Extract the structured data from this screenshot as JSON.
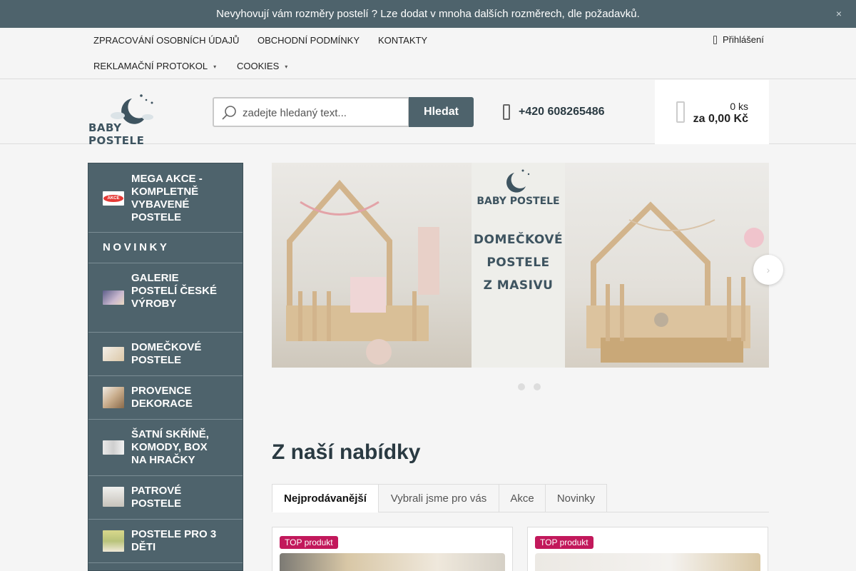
{
  "announcement": {
    "text": "Nevyhovují vám rozměry postelí ? Lze dodat v mnoha dalších rozměrech, dle požadavků.",
    "close_icon": "×"
  },
  "topnav": {
    "links": [
      "ZPRACOVÁNÍ OSOBNÍCH ÚDAJŮ",
      "OBCHODNÍ PODMÍNKY",
      "KONTAKTY",
      "REKLAMAČNÍ PROTOKOL",
      "COOKIES"
    ],
    "caret": "▾",
    "login": "Přihlášení"
  },
  "header": {
    "logo_text": "BABY POSTELE",
    "search_placeholder": "zadejte hledaný text...",
    "search_button": "Hledat",
    "phone": "+420 608265486",
    "cart_count": "0 ks",
    "cart_total": "za 0,00 Kč"
  },
  "sidebar": {
    "items": [
      {
        "label": "MEGA AKCE - KOMPLETNĚ VYBAVENÉ POSTELE",
        "thumb": "akce-badge",
        "thumb_text": "AKCE"
      },
      {
        "label": "NOVINKY",
        "thumb": ""
      },
      {
        "label": "GALERIE POSTELÍ ČESKÉ VÝROBY",
        "thumb": "gallery-photo"
      },
      {
        "label": "DOMEČKOVÉ POSTELE",
        "thumb": "house-bed-photo"
      },
      {
        "label": "PROVENCE DEKORACE",
        "thumb": "decor-photo"
      },
      {
        "label": "ŠATNÍ SKŘÍNĚ, KOMODY, BOX NA HRAČKY",
        "thumb": "wardrobe-photo"
      },
      {
        "label": "PATROVÉ POSTELE",
        "thumb": "bunk-bed-photo"
      },
      {
        "label": "POSTELE PRO 3 DĚTI",
        "thumb": "triple-bed-photo"
      }
    ]
  },
  "banner": {
    "brand": "BABY POSTELE",
    "lines": [
      "DOMEČKOVÉ",
      "POSTELE",
      "Z MASIVU"
    ],
    "next_icon": "›"
  },
  "offer": {
    "title": "Z naší nabídky",
    "tabs": [
      "Nejprodávanější",
      "Vybrali jsme pro vás",
      "Akce",
      "Novinky"
    ],
    "active_tab": 0,
    "cards": [
      {
        "badge": "TOP produkt"
      },
      {
        "badge": "TOP produkt"
      }
    ]
  },
  "colors": {
    "brand": "#4e636c",
    "badge": "#c2185b",
    "background": "#f5f5f5"
  }
}
